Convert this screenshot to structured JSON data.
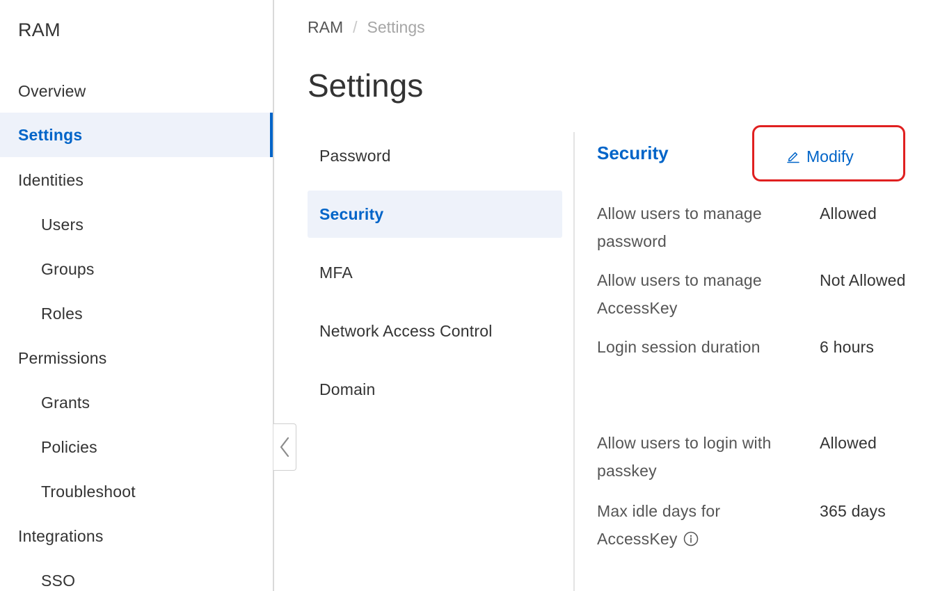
{
  "sidebar": {
    "title": "RAM",
    "items": [
      {
        "label": "Overview"
      },
      {
        "label": "Settings"
      },
      {
        "label": "Identities"
      },
      {
        "label": "Users"
      },
      {
        "label": "Groups"
      },
      {
        "label": "Roles"
      },
      {
        "label": "Permissions"
      },
      {
        "label": "Grants"
      },
      {
        "label": "Policies"
      },
      {
        "label": "Troubleshoot"
      },
      {
        "label": "Integrations"
      },
      {
        "label": "SSO"
      }
    ],
    "active_item": "Settings"
  },
  "breadcrumb": {
    "root": "RAM",
    "separator": "/",
    "current": "Settings"
  },
  "page": {
    "title": "Settings"
  },
  "tabs": [
    {
      "label": "Password"
    },
    {
      "label": "Security"
    },
    {
      "label": "MFA"
    },
    {
      "label": "Network Access Control"
    },
    {
      "label": "Domain"
    }
  ],
  "active_tab": "Security",
  "security": {
    "title": "Security",
    "modify_label": "Modify",
    "rows": [
      {
        "label": "Allow users to manage password",
        "value": "Allowed"
      },
      {
        "label": "Allow users to manage AccessKey",
        "value": "Not Allowed"
      },
      {
        "label": "Login session duration",
        "value": "6 hours"
      },
      {
        "label": "Allow users to login with passkey",
        "value": "Allowed"
      },
      {
        "label": "Max idle days for AccessKey",
        "value": "365 days"
      }
    ]
  },
  "colors": {
    "accent": "#0064c8",
    "active_bg": "#eef2fa",
    "highlight_box": "#e02020"
  },
  "icons": {
    "modify": "pencil-icon",
    "info": "info-icon",
    "collapse": "chevron-left-icon"
  }
}
